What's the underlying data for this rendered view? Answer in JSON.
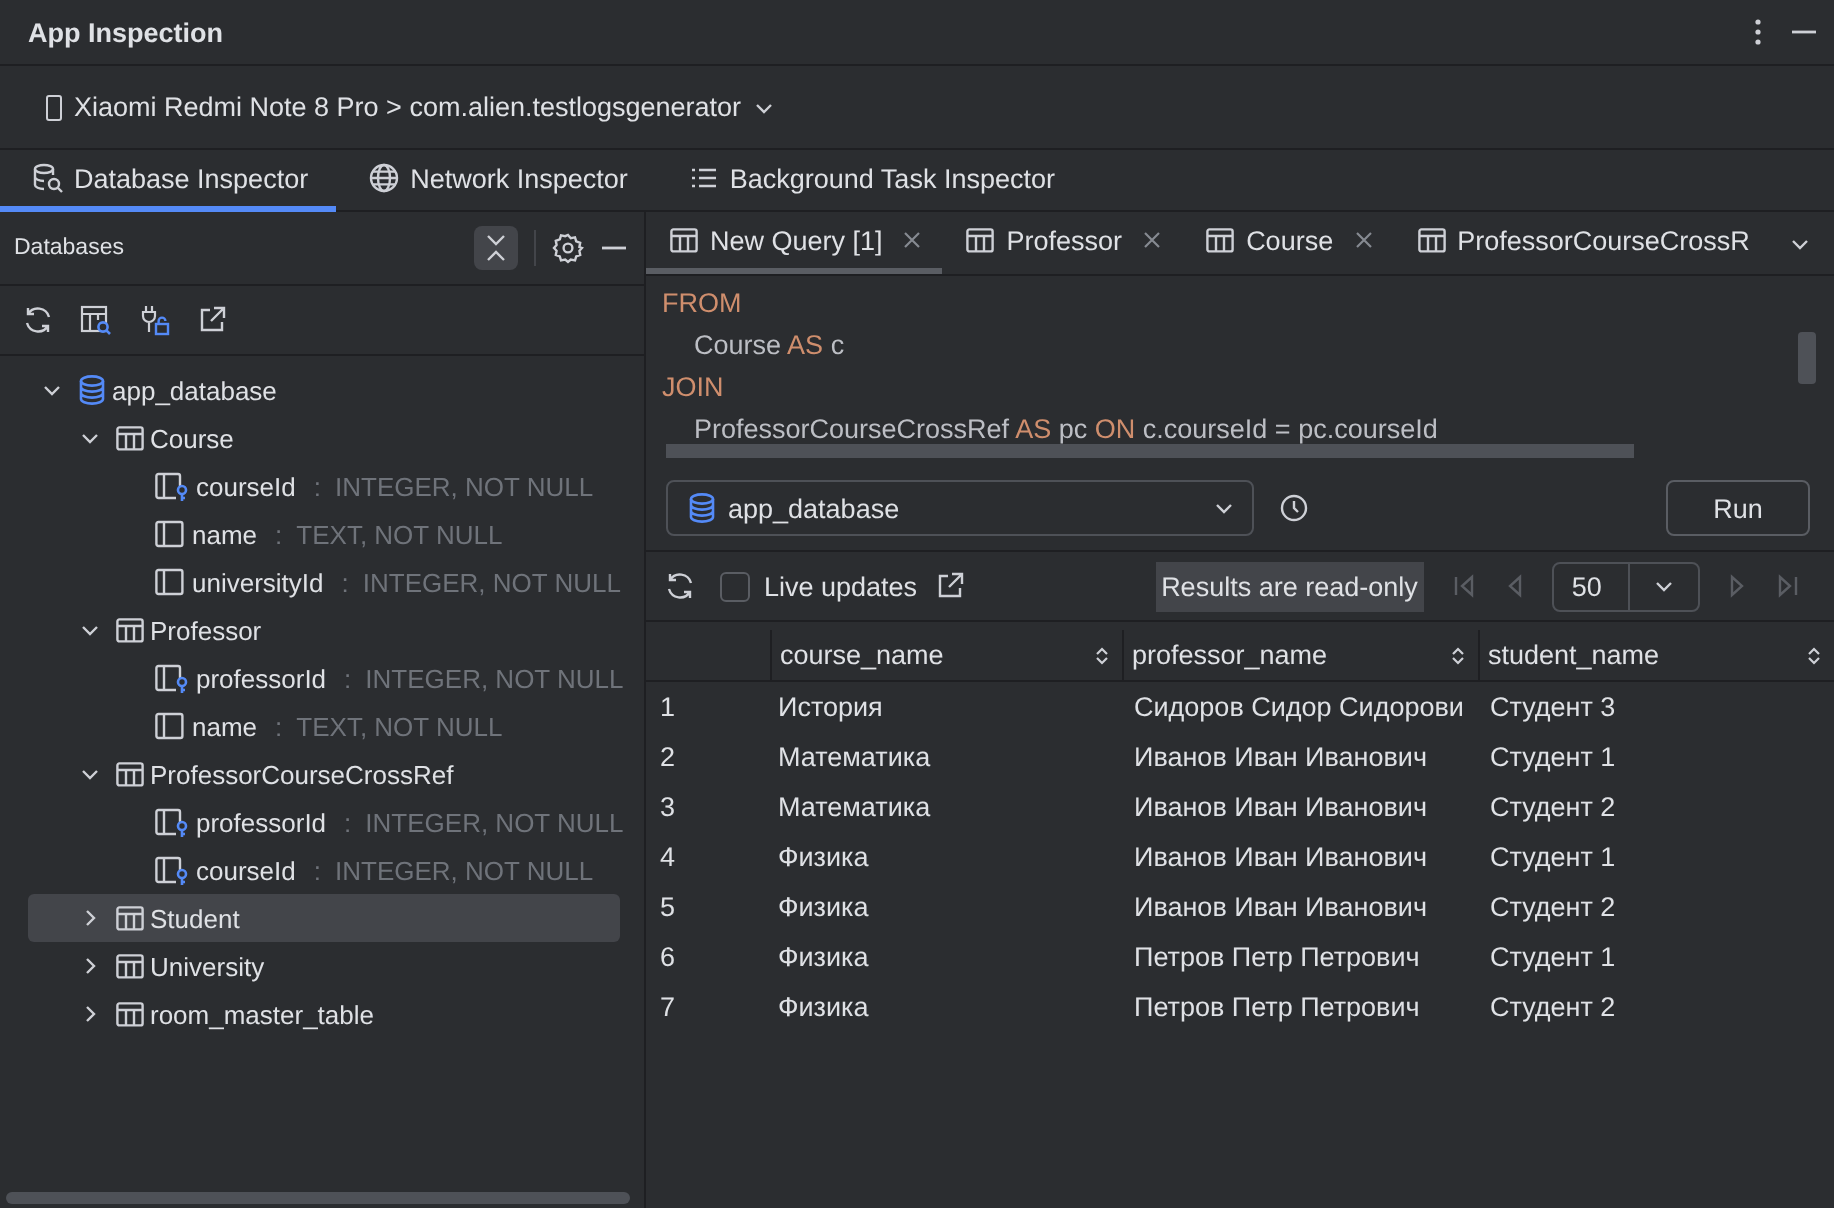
{
  "window": {
    "title": "App Inspection"
  },
  "device_selector": {
    "value": "Xiaomi Redmi Note 8 Pro > com.alien.testlogsgenerator"
  },
  "inspector_tabs": [
    {
      "label": "Database Inspector",
      "kind": "database",
      "selected": true
    },
    {
      "label": "Network Inspector",
      "kind": "network",
      "selected": false
    },
    {
      "label": "Background Task Inspector",
      "kind": "tasks",
      "selected": false
    }
  ],
  "databases_panel": {
    "title": "Databases",
    "tree": [
      {
        "label": "app_database",
        "kind": "database",
        "expanded": true,
        "selected": false,
        "children": [
          {
            "label": "Course",
            "kind": "table",
            "expanded": true,
            "selected": false,
            "children": [
              {
                "label": "courseId",
                "kind": "primary_key",
                "separator": ":",
                "type": "INTEGER, NOT NULL",
                "selected": false
              },
              {
                "label": "name",
                "kind": "column",
                "separator": ":",
                "type": "TEXT, NOT NULL",
                "selected": false
              },
              {
                "label": "universityId",
                "kind": "column",
                "separator": ":",
                "type": "INTEGER, NOT NULL",
                "selected": false
              }
            ]
          },
          {
            "label": "Professor",
            "kind": "table",
            "expanded": true,
            "selected": false,
            "children": [
              {
                "label": "professorId",
                "kind": "primary_key",
                "separator": ":",
                "type": "INTEGER, NOT NULL",
                "selected": false
              },
              {
                "label": "name",
                "kind": "column",
                "separator": ":",
                "type": "TEXT, NOT NULL",
                "selected": false
              }
            ]
          },
          {
            "label": "ProfessorCourseCrossRef",
            "kind": "table",
            "expanded": true,
            "selected": false,
            "children": [
              {
                "label": "professorId",
                "kind": "primary_key",
                "separator": ":",
                "type": "INTEGER, NOT NULL",
                "selected": false
              },
              {
                "label": "courseId",
                "kind": "primary_key",
                "separator": ":",
                "type": "INTEGER, NOT NULL",
                "selected": false
              }
            ]
          },
          {
            "label": "Student",
            "kind": "table",
            "expanded": false,
            "selected": true
          },
          {
            "label": "University",
            "kind": "table",
            "expanded": false,
            "selected": false
          },
          {
            "label": "room_master_table",
            "kind": "table",
            "expanded": false,
            "selected": false
          }
        ]
      }
    ]
  },
  "query_tabs": [
    {
      "label": "New Query [1]",
      "selected": true,
      "closable": true
    },
    {
      "label": "Professor",
      "selected": false,
      "closable": true
    },
    {
      "label": "Course",
      "selected": false,
      "closable": true
    },
    {
      "label": "ProfessorCourseCrossR",
      "selected": false,
      "closable": false
    }
  ],
  "query_lines": [
    {
      "indent": false,
      "tokens": [
        {
          "kind": "keyword",
          "text": "FROM"
        }
      ]
    },
    {
      "indent": true,
      "tokens": [
        {
          "kind": "text",
          "text": "Course"
        },
        {
          "kind": "keyword",
          "text": "AS"
        },
        {
          "kind": "text",
          "text": "c"
        }
      ]
    },
    {
      "indent": false,
      "tokens": [
        {
          "kind": "keyword",
          "text": "JOIN"
        }
      ]
    },
    {
      "indent": true,
      "tokens": [
        {
          "kind": "text",
          "text": "ProfessorCourseCrossRef"
        },
        {
          "kind": "keyword",
          "text": "AS"
        },
        {
          "kind": "text",
          "text": "pc"
        },
        {
          "kind": "keyword",
          "text": "ON"
        },
        {
          "kind": "text",
          "text": "c.courseId = pc.courseId"
        }
      ]
    }
  ],
  "database_select": {
    "value": "app_database"
  },
  "run_button": {
    "label": "Run"
  },
  "results_toolbar": {
    "live_updates": {
      "label": "Live updates",
      "checked": false
    },
    "read_only_notice": "Results are read-only",
    "page_size": "50"
  },
  "table": {
    "columns": [
      "course_name",
      "professor_name",
      "student_name"
    ],
    "rows": [
      {
        "number": "1",
        "cells": [
          "История",
          "Сидоров Сидор Сидорови",
          "Студент 3"
        ]
      },
      {
        "number": "2",
        "cells": [
          "Математика",
          "Иванов Иван Иванович",
          "Студент 1"
        ]
      },
      {
        "number": "3",
        "cells": [
          "Математика",
          "Иванов Иван Иванович",
          "Студент 2"
        ]
      },
      {
        "number": "4",
        "cells": [
          "Физика",
          "Иванов Иван Иванович",
          "Студент 1"
        ]
      },
      {
        "number": "5",
        "cells": [
          "Физика",
          "Иванов Иван Иванович",
          "Студент 2"
        ]
      },
      {
        "number": "6",
        "cells": [
          "Физика",
          "Петров Петр Петрович",
          "Студент 1"
        ]
      },
      {
        "number": "7",
        "cells": [
          "Физика",
          "Петров Петр Петрович",
          "Студент 2"
        ]
      }
    ]
  }
}
